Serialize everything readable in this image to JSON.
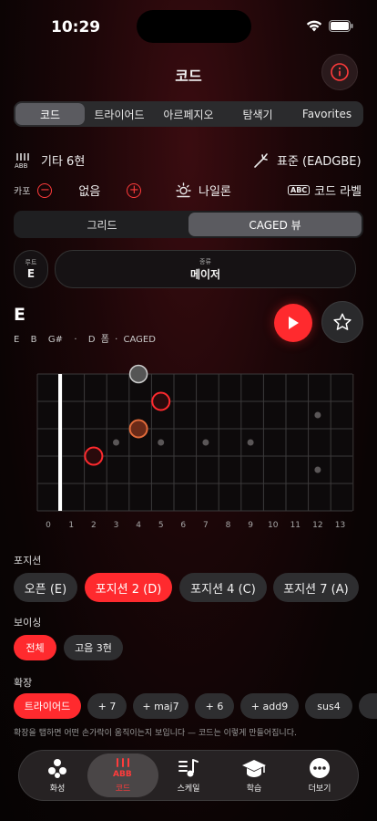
{
  "status": {
    "time": "10:29"
  },
  "header": {
    "title": "코드",
    "info_icon": "info-icon"
  },
  "tabs": [
    "코드",
    "트라이어드",
    "아르페지오",
    "탐색기",
    "Favorites"
  ],
  "instrument": {
    "label": "기타 6현",
    "tuning": "표준 (EADGBE)"
  },
  "capo": {
    "label": "카포",
    "value": "없음"
  },
  "string_type": "나일론",
  "chord_label": {
    "badge": "ABC",
    "text": "코드 라벨"
  },
  "view_toggle": [
    "그리드",
    "CAGED 뷰"
  ],
  "root": {
    "label": "루트",
    "value": "E"
  },
  "type": {
    "label": "종류",
    "value": "메이저"
  },
  "chord": {
    "name": "E",
    "notes": "E  B  G#  ·  D 폼 · CAGED"
  },
  "fret_numbers": [
    "0",
    "1",
    "2",
    "3",
    "4",
    "5",
    "6",
    "7",
    "8",
    "9",
    "10",
    "11",
    "12",
    "13"
  ],
  "positions": {
    "label": "포지션",
    "items": [
      "오픈 (E)",
      "포지션 2 (D)",
      "포지션 4 (C)",
      "포지션 7 (A)"
    ]
  },
  "voicing": {
    "label": "보이싱",
    "items": [
      "전체",
      "고음 3현"
    ]
  },
  "extensions": {
    "label": "확장",
    "items": [
      "트라이어드",
      "+ 7",
      "+ maj7",
      "+ 6",
      "+ add9",
      "sus4"
    ]
  },
  "hint": "확장을 탭하면 어떤 손가락이 움직이는지 보입니다 — 코드는 이렇게 만들어집니다.",
  "tabbar": [
    "화성",
    "코드",
    "스케일",
    "학습",
    "더보기"
  ],
  "colors": {
    "accent": "#ff2a2e",
    "orange_note": "#e06a3a"
  }
}
